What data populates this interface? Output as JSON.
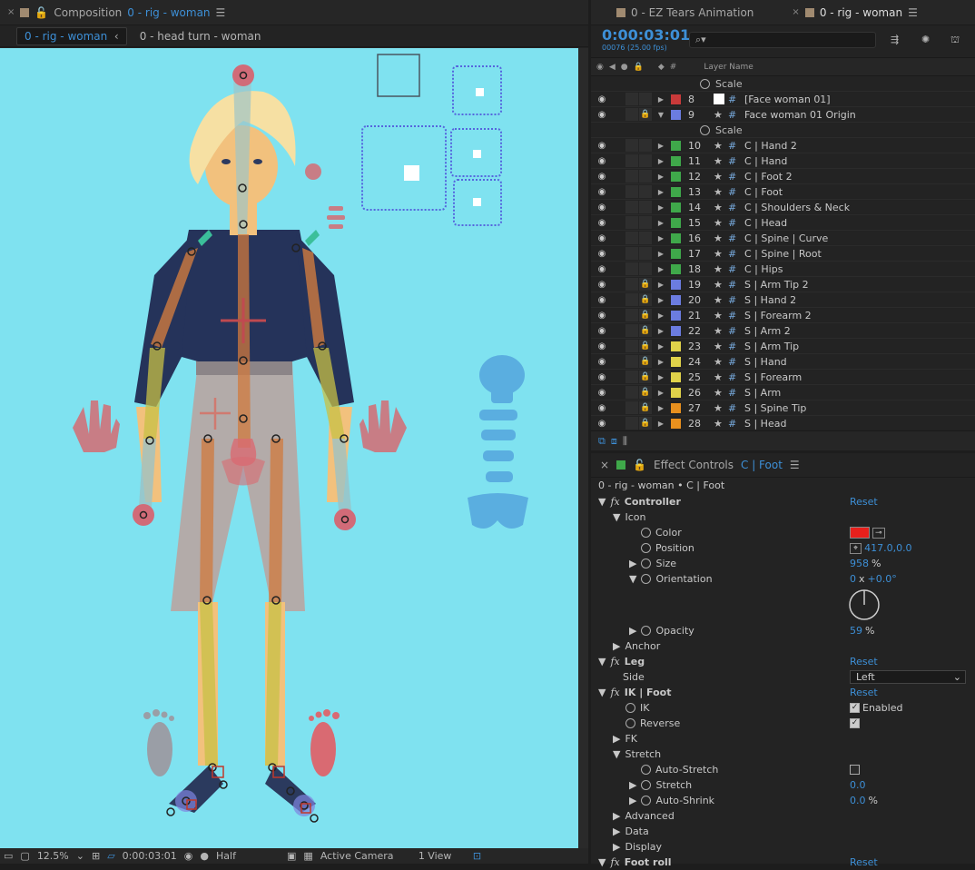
{
  "composition_panel": {
    "tab_close": "×",
    "tab_label": "Composition",
    "tab_name": "0 - rig - woman",
    "tab_menu": "☰",
    "crumb_active": "0 - rig - woman",
    "crumb_arrow": "‹",
    "crumb_next": "0 - head turn - woman"
  },
  "viewer_bar": {
    "zoom": "12.5%",
    "timecode": "0:00:03:01",
    "resolution": "Half",
    "camera": "Active Camera",
    "view": "1 View"
  },
  "timeline": {
    "tabs": [
      {
        "close": "×",
        "label": "0 - EZ Tears Animation",
        "color": "#a08a70"
      },
      {
        "close": "×",
        "label": "0 - rig - woman",
        "color": "#a08a70",
        "menu": "☰"
      }
    ],
    "timecode": "0:00:03:01",
    "frame_info": "00076 (25.00 fps)",
    "search_placeholder": "⌕▾",
    "layer_name_header": "Layer Name",
    "hash_header": "#",
    "rows": [
      {
        "type": "sub",
        "label": "Scale"
      },
      {
        "num": "8",
        "color": "#c93a3a",
        "name": "[Face woman 01]",
        "lock": false,
        "solid": true,
        "expanded": false
      },
      {
        "num": "9",
        "color": "#6b7ce0",
        "name": "Face woman 01 Origin",
        "lock": true,
        "expanded": true
      },
      {
        "type": "sub",
        "label": "Scale"
      },
      {
        "num": "10",
        "color": "#3fa84a",
        "name": "C | Hand 2",
        "lock": false
      },
      {
        "num": "11",
        "color": "#3fa84a",
        "name": "C | Hand",
        "lock": false
      },
      {
        "num": "12",
        "color": "#3fa84a",
        "name": "C | Foot 2",
        "lock": false
      },
      {
        "num": "13",
        "color": "#3fa84a",
        "name": "C | Foot",
        "lock": false
      },
      {
        "num": "14",
        "color": "#3fa84a",
        "name": "C | Shoulders & Neck",
        "lock": false
      },
      {
        "num": "15",
        "color": "#3fa84a",
        "name": "C | Head",
        "lock": false
      },
      {
        "num": "16",
        "color": "#3fa84a",
        "name": "C | Spine | Curve",
        "lock": false
      },
      {
        "num": "17",
        "color": "#3fa84a",
        "name": "C | Spine | Root",
        "lock": false
      },
      {
        "num": "18",
        "color": "#3fa84a",
        "name": "C | Hips",
        "lock": false
      },
      {
        "num": "19",
        "color": "#6b7ce0",
        "name": "S | Arm Tip 2",
        "lock": true
      },
      {
        "num": "20",
        "color": "#6b7ce0",
        "name": "S | Hand 2",
        "lock": true
      },
      {
        "num": "21",
        "color": "#6b7ce0",
        "name": "S | Forearm 2",
        "lock": true
      },
      {
        "num": "22",
        "color": "#6b7ce0",
        "name": "S | Arm 2",
        "lock": true
      },
      {
        "num": "23",
        "color": "#e0d24a",
        "name": "S | Arm Tip",
        "lock": true
      },
      {
        "num": "24",
        "color": "#e0d24a",
        "name": "S | Hand",
        "lock": true
      },
      {
        "num": "25",
        "color": "#e0d24a",
        "name": "S | Forearm",
        "lock": true
      },
      {
        "num": "26",
        "color": "#e0d24a",
        "name": "S | Arm",
        "lock": true
      },
      {
        "num": "27",
        "color": "#e8901e",
        "name": "S | Spine Tip",
        "lock": true
      },
      {
        "num": "28",
        "color": "#e8901e",
        "name": "S | Head",
        "lock": true
      }
    ]
  },
  "effect_controls": {
    "close": "×",
    "title_prefix": "Effect Controls",
    "title_layer": "C | Foot",
    "menu": "☰",
    "path": "0 - rig - woman • C | Foot",
    "reset": "Reset",
    "fx": "fx",
    "controller": "Controller",
    "icon": "Icon",
    "color": "Color",
    "color_value": "#e8201c",
    "position": "Position",
    "position_value": "417.0,0.0",
    "size": "Size",
    "size_value": "958",
    "size_unit": "%",
    "orientation": "Orientation",
    "orientation_rev": "0",
    "orientation_sep": "x",
    "orientation_deg": "+0.0°",
    "opacity": "Opacity",
    "opacity_value": "59",
    "opacity_unit": "%",
    "anchor": "Anchor",
    "leg": "Leg",
    "side": "Side",
    "side_value": "Left",
    "ik_foot": "IK | Foot",
    "ik": "IK",
    "ik_enabled": "Enabled",
    "reverse": "Reverse",
    "fk": "FK",
    "stretch_group": "Stretch",
    "auto_stretch": "Auto-Stretch",
    "stretch": "Stretch",
    "stretch_value": "0.0",
    "auto_shrink": "Auto-Shrink",
    "auto_shrink_value": "0.0",
    "auto_shrink_unit": "%",
    "advanced": "Advanced",
    "data": "Data",
    "display": "Display",
    "foot_roll": "Foot roll"
  }
}
